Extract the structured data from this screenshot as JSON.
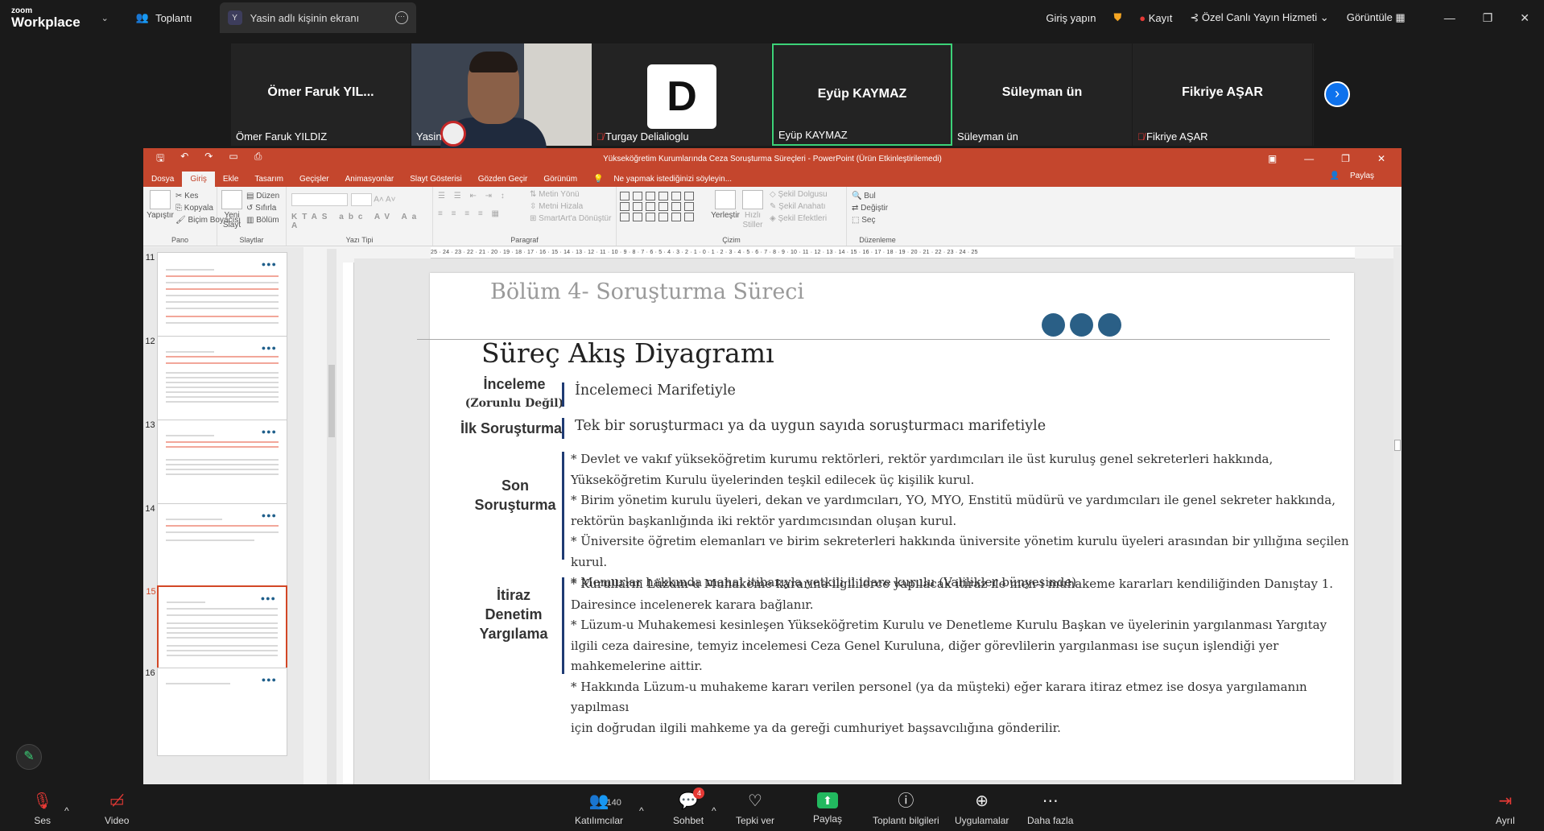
{
  "app": {
    "brand_top": "zoom",
    "brand_bottom": "Workplace"
  },
  "topbar": {
    "meeting_label": "Toplantı",
    "screen_tab_avatar": "Y",
    "screen_tab_label": "Yasin adlı kişinin ekranı",
    "signin": "Giriş yapın",
    "record": "Kayıt",
    "live": "Özel Canlı Yayın Hizmeti",
    "view": "Görüntüle"
  },
  "participants": [
    {
      "name": "Ömer Faruk YIL...",
      "caption": "Ömer Faruk YILDIZ",
      "muted": false
    },
    {
      "name": "",
      "caption": "Yasin",
      "muted": false
    },
    {
      "name": "",
      "caption": "Turgay Delialioglu",
      "muted": true
    },
    {
      "name": "Eyüp KAYMAZ",
      "caption": "Eyüp KAYMAZ",
      "muted": false
    },
    {
      "name": "Süleyman ün",
      "caption": "Süleyman ün",
      "muted": false
    },
    {
      "name": "Fikriye AŞAR",
      "caption": "Fikriye AŞAR",
      "muted": true
    }
  ],
  "ppt": {
    "doc_title": "Yükseköğretim Kurumlarında Ceza Soruşturma Süreçleri - PowerPoint (Ürün Etkinleştirilemedi)",
    "tabs": [
      "Dosya",
      "Giriş",
      "Ekle",
      "Tasarım",
      "Geçişler",
      "Animasyonlar",
      "Slayt Gösterisi",
      "Gözden Geçir",
      "Görünüm"
    ],
    "tellme": "Ne yapmak istediğinizi söyleyin...",
    "share": "Paylaş",
    "ribbon": {
      "paste": "Yapıştır",
      "cut": "Kes",
      "copy": "Kopyala",
      "format_painter": "Biçim Boyacısı",
      "group_clipboard": "Pano",
      "new_slide": "Yeni Slayt",
      "layout": "Düzen",
      "reset": "Sıfırla",
      "section": "Bölüm",
      "group_slides": "Slaytlar",
      "group_font": "Yazı Tipi",
      "text_direction": "Metin Yönü",
      "align_text": "Metni Hizala",
      "smartart": "SmartArt'a Dönüştür",
      "group_paragraph": "Paragraf",
      "arrange": "Yerleştir",
      "quick_styles": "Hızlı Stiller",
      "shape_fill": "Şekil Dolgusu",
      "shape_outline": "Şekil Anahatı",
      "shape_effects": "Şekil Efektleri",
      "group_drawing": "Çizim",
      "find": "Bul",
      "replace": "Değiştir",
      "select": "Seç",
      "group_editing": "Düzenleme"
    },
    "ruler_text": "25 · 24 · 23 · 22 · 21 · 20 · 19 · 18 · 17 · 16 · 15 · 14 · 13 · 12 · 11 · 10 · 9 · 8 · 7 · 6 · 5 · 4 · 3 · 2 · 1 · 0 · 1 · 2 · 3 · 4 · 5 · 6 · 7 · 8 · 9 · 10 · 11 · 12 · 13 · 14 · 15 · 16 · 17 · 18 · 19 · 20 · 21 · 22 · 23 · 24 · 25",
    "thumbnails": [
      {
        "num": "11"
      },
      {
        "num": "12"
      },
      {
        "num": "13"
      },
      {
        "num": "14"
      },
      {
        "num": "15"
      },
      {
        "num": "16"
      }
    ],
    "selected_thumb": "15"
  },
  "slide": {
    "section": "Bölüm 4- Soruşturma Süreci",
    "heading": "Süreç Akış Diyagramı",
    "rows": [
      {
        "label": "İnceleme",
        "sublabel": "(Zorunlu Değil)",
        "text": [
          "İncelemeci Marifetiyle"
        ]
      },
      {
        "label": "İlk Soruşturma",
        "sublabel": "",
        "text": [
          "Tek bir soruşturmacı ya da uygun sayıda soruşturmacı marifetiyle"
        ]
      },
      {
        "label": "Son Soruşturma",
        "sublabel": "",
        "text": [
          " * Devlet ve vakıf yükseköğretim kurumu rektörleri, rektör yardımcıları ile üst kuruluş genel sekreterleri hakkında,",
          "Yükseköğretim Kurulu üyelerinden teşkil edilecek üç kişilik kurul.",
          " *  Birim yönetim kurulu üyeleri, dekan ve yardımcıları, YO, MYO, Enstitü müdürü ve yardımcıları ile genel sekreter hakkında,",
          "rektörün başkanlığında iki rektör yardımcısından oluşan kurul.",
          "* Üniversite öğretim elemanları ve birim sekreterleri hakkında üniversite yönetim kurulu üyeleri arasından bir yıllığına seçilen",
          "kurul.",
          "* Memurlar hakkında mahal itibarıyla yetkili il idare kurulu (Valilikler bünyesinde)"
        ]
      },
      {
        "label": "İtiraz Denetim Yargılama",
        "sublabel": "",
        "text": [
          " * Kurulların Lüzum-u Muhakeme kararına ilgililerce yapılacak itiraz ile men-i muhakeme kararları kendiliğinden Danıştay 1.",
          "Dairesince incelenerek karara bağlanır.",
          " *  Lüzum-u Muhakemesi kesinleşen  Yükseköğretim Kurulu ve Denetleme Kurulu Başkan ve üyelerinin yargılanması Yargıtay",
          "ilgili ceza dairesine, temyiz incelemesi Ceza Genel Kuruluna, diğer görevlilerin yargılanması ise suçun işlendiği yer",
          "mahkemelerine aittir.",
          "* Hakkında Lüzum-u muhakeme kararı verilen personel (ya da müşteki) eğer karara itiraz etmez ise dosya yargılamanın yapılması",
          "için doğrudan ilgili mahkeme ya da gereği  cumhuriyet başsavcılığına gönderilir."
        ]
      }
    ]
  },
  "bottombar": {
    "audio": "Ses",
    "video": "Video",
    "participants": "Katılımcılar",
    "participant_count": "140",
    "chat": "Sohbet",
    "chat_badge": "4",
    "react": "Tepki ver",
    "share": "Paylaş",
    "info": "Toplantı bilgileri",
    "apps": "Uygulamalar",
    "more": "Daha fazla",
    "leave": "Ayrıl"
  },
  "colors": {
    "accent_green": "#3cd278",
    "zoom_blue": "#0e72ed",
    "ppt_red": "#c4462d",
    "danger": "#e53935"
  }
}
